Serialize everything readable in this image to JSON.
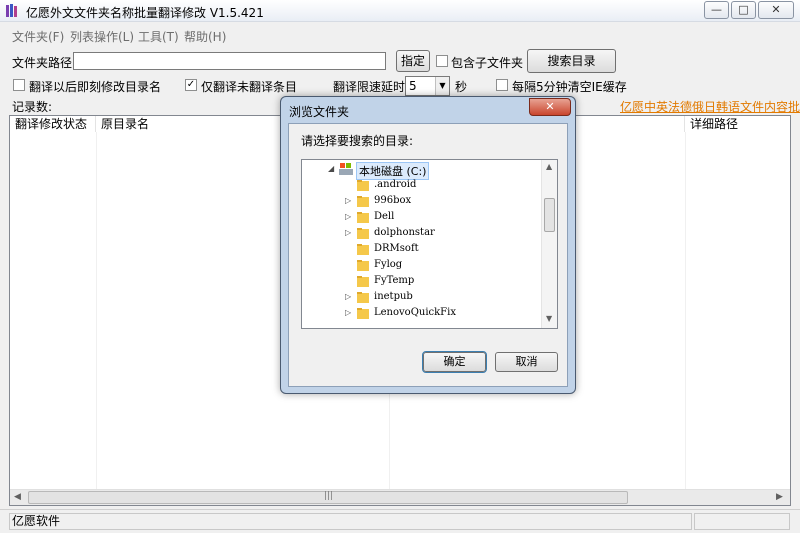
{
  "window": {
    "title": "亿愿外文文件夹名称批量翻译修改 V1.5.421",
    "minimize_glyph": "—",
    "maximize_glyph": "□",
    "close_glyph": "✕"
  },
  "menu": {
    "items": [
      "文件夹(F)",
      "列表操作(L)",
      "工具(T)",
      "帮助(H)"
    ]
  },
  "form": {
    "folder_path_label": "文件夹路径:",
    "folder_path_value": "",
    "specify_button": "指定",
    "include_subfolders": {
      "label": "包含子文件夹",
      "checked": false
    },
    "search_button": "搜索目录",
    "rename_immediately": {
      "label": "翻译以后即刻修改目录名",
      "checked": false
    },
    "only_untranslated": {
      "label": "仅翻译未翻译条目",
      "checked": true
    },
    "delay_label": "翻译限速延时:",
    "delay_value": "5",
    "delay_unit": "秒",
    "clear_cache": {
      "label": "每隔5分钟清空IE缓存",
      "checked": false
    },
    "records_label": "记录数:",
    "promo_link": "亿愿中英法德俄日韩语文件内容批量翻"
  },
  "table": {
    "columns": [
      "翻译修改状态",
      "原目录名",
      "",
      "详细路径"
    ]
  },
  "status": {
    "text": "亿愿软件"
  },
  "dialog": {
    "title": "浏览文件夹",
    "close_glyph": "✕",
    "prompt": "请选择要搜索的目录:",
    "tree": {
      "root": "本地磁盘 (C:)",
      "items": [
        ".android",
        "996box",
        "Dell",
        "dolphonstar",
        "DRMsoft",
        "Fylog",
        "FyTemp",
        "inetpub",
        "LenovoQuickFix"
      ]
    },
    "ok_button": "确定",
    "cancel_button": "取消"
  },
  "colors": {
    "link": "#e27a00",
    "dialog_frame": "#c1d3e8",
    "close_red": "#c9452d",
    "folder_yellow": "#f5c84a"
  }
}
